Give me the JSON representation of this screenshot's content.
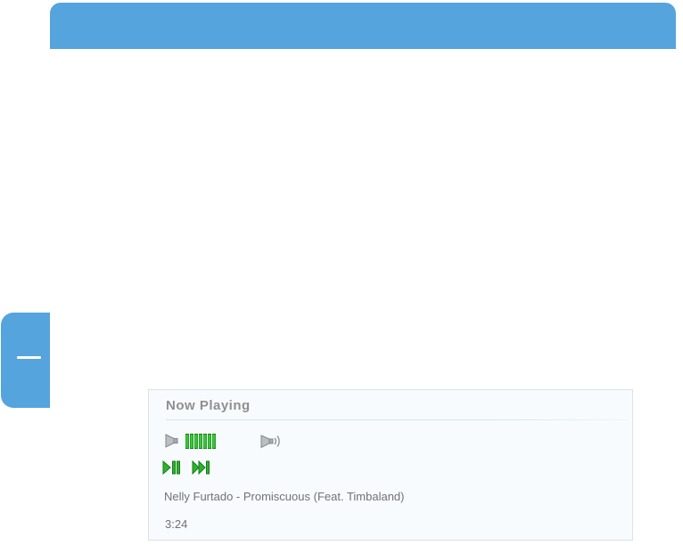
{
  "now_playing": {
    "header": "Now Playing",
    "track": "Nelly Furtado - Promiscuous (Feat. Timbaland)",
    "elapsed": "3:24",
    "volume_bars": 7
  },
  "icons": {
    "volume_low": "speaker-icon",
    "volume_max": "speaker-waves-icon",
    "play_pause": "play-pause-icon",
    "next_track": "next-track-icon",
    "side_tab_dash": "minimize-dash-icon"
  },
  "colors": {
    "accent_blue": "#55a4dd",
    "icon_green": "#2eb230",
    "icon_green_dark": "#147d16",
    "panel_background": "#f8fbfd",
    "panel_border": "#d6e4ec",
    "header_text": "#8f8f8f",
    "body_text": "#71717b",
    "speaker_gray": "#b9bfc4"
  }
}
